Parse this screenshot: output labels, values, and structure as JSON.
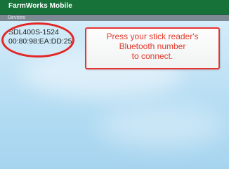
{
  "app_bar": {
    "title": "FarmWorks Mobile"
  },
  "section": {
    "label": "Devices"
  },
  "device": {
    "name": "SDL400S-1524",
    "address": "00:80:98:EA:DD:25"
  },
  "callout": {
    "lines": [
      "Press your stick reader's",
      "Bluetooth number",
      "to connect."
    ]
  },
  "colors": {
    "app_bar": "#17723a",
    "section_bar": "#7e8a93",
    "highlight": "#e32626",
    "callout_text": "#e23a2c"
  }
}
